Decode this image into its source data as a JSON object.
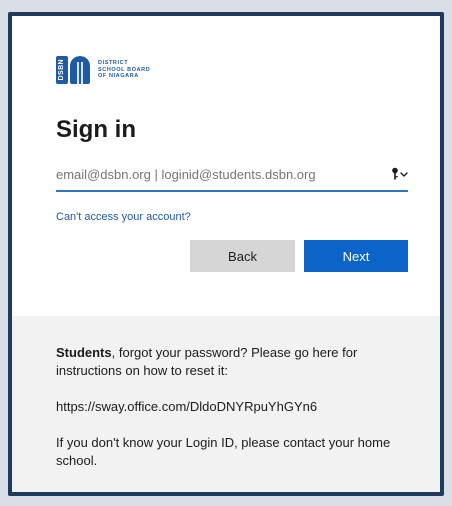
{
  "logo": {
    "mark_text": "DSBN",
    "org_line_1": "DISTRICT",
    "org_line_2": "SCHOOL BOARD",
    "org_line_3": "OF NIAGARA"
  },
  "signin": {
    "title": "Sign in",
    "input_value": "email@dsbn.org | loginid@students.dsbn.org",
    "input_placeholder": "email@dsbn.org | loginid@students.dsbn.org",
    "cant_access_link": "Can't access your account?",
    "back_label": "Back",
    "next_label": "Next"
  },
  "help": {
    "students_bold": "Students",
    "students_text": ", forgot your password? Please go here for instructions on how to reset it:",
    "reset_url": "https://sway.office.com/DldoDNYRpuYhGYn6",
    "login_id_text": "If you don't know your Login ID, please contact your home school."
  },
  "colors": {
    "accent_blue": "#0b64c7",
    "link_blue": "#1f5aa8",
    "frame_navy": "#1f3a5f",
    "help_bg": "#f2f2f2"
  },
  "icons": {
    "key": "key-icon",
    "chevron": "chevron-down-icon"
  }
}
